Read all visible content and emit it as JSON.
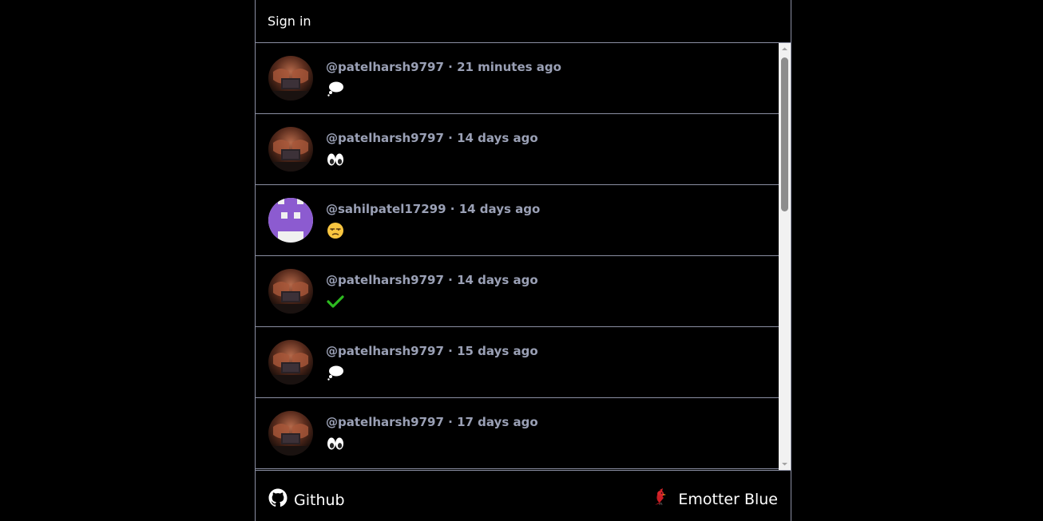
{
  "header": {
    "sign_in_label": "Sign in"
  },
  "feed": {
    "posts": [
      {
        "handle": "@patelharsh9797",
        "separator": " · ",
        "time": "21 minutes ago",
        "emoji_name": "thought-balloon",
        "avatar": "photo"
      },
      {
        "handle": "@patelharsh9797",
        "separator": " · ",
        "time": "14 days ago",
        "emoji_name": "eyes",
        "avatar": "photo"
      },
      {
        "handle": "@sahilpatel17299",
        "separator": " · ",
        "time": "14 days ago",
        "emoji_name": "unamused-face",
        "avatar": "identicon"
      },
      {
        "handle": "@patelharsh9797",
        "separator": " · ",
        "time": "14 days ago",
        "emoji_name": "check-mark",
        "avatar": "photo"
      },
      {
        "handle": "@patelharsh9797",
        "separator": " · ",
        "time": "15 days ago",
        "emoji_name": "thought-balloon",
        "avatar": "photo"
      },
      {
        "handle": "@patelharsh9797",
        "separator": " · ",
        "time": "17 days ago",
        "emoji_name": "eyes",
        "avatar": "photo"
      }
    ]
  },
  "footer": {
    "github_label": "Github",
    "brand_label": "Emotter Blue"
  },
  "colors": {
    "background": "#000000",
    "border": "#8b8fa3",
    "meta_text": "#9aa0b5",
    "identicon": "#8c5bd0",
    "check": "#2dbb20"
  }
}
